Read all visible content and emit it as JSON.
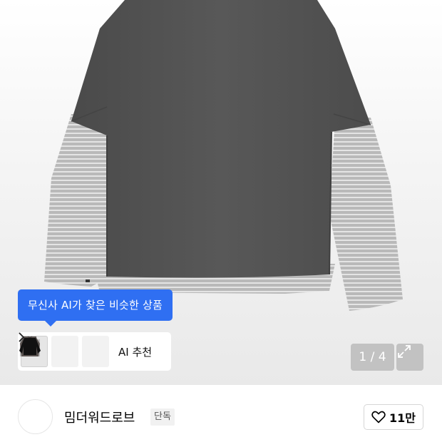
{
  "product_gallery": {
    "image_alt": "Gray layered long sleeve t-shirt with striped sleeves",
    "tooltip_text": "무신사 AI가 찾은 비슷한 상품",
    "ai_recommend_label": "AI 추천",
    "page_counter": "1 / 4",
    "thumbnails": [
      {
        "icon": "gray-layered-tee",
        "selected": true
      },
      {
        "icon": "charcoal-sweater",
        "selected": false
      },
      {
        "icon": "black-sweater",
        "selected": false
      }
    ]
  },
  "brand": {
    "name": "밈더워드로브",
    "badge": "단독"
  },
  "like": {
    "count": "11만",
    "icon": "heart-outline-icon"
  },
  "colors": {
    "tooltip_blue": "#2f6ff2",
    "shirt_body": "#555555",
    "sleeve_gray": "#bdbdbd"
  }
}
